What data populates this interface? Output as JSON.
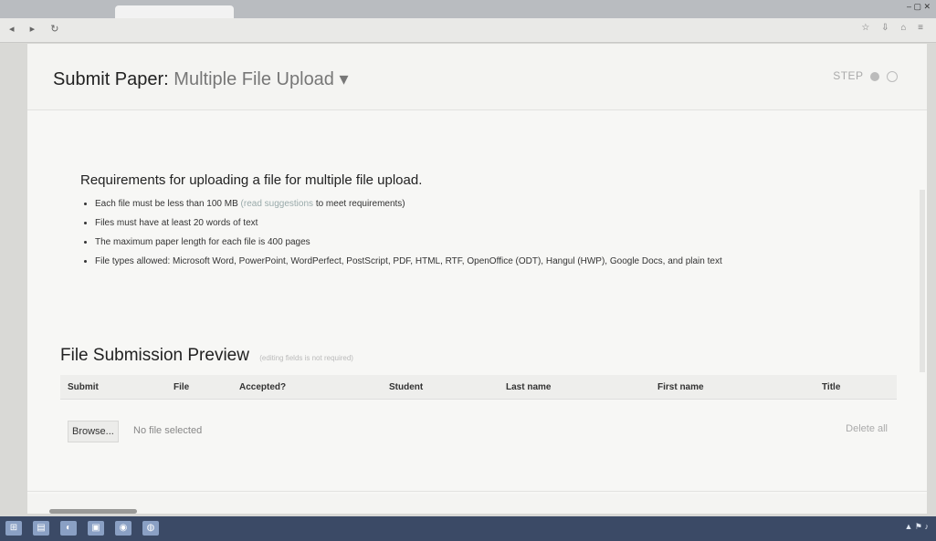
{
  "browser": {
    "tab_title": "",
    "url": "",
    "window_controls": "– ▢ ✕",
    "nav_icons": [
      "back-icon",
      "forward-icon",
      "refresh-icon"
    ],
    "toolbar_icons": [
      "bookmark-icon",
      "download-icon",
      "home-icon",
      "menu-icon"
    ]
  },
  "page": {
    "title_prefix": "Submit Paper:",
    "title_mode": "Multiple File Upload",
    "title_caret": "▾",
    "step_label": "STEP"
  },
  "requirements": {
    "heading": "Requirements for uploading a file for multiple file upload.",
    "items": [
      {
        "text": "Each file must be less than 100 MB",
        "link": "(read suggestions",
        "tail": "to meet requirements)"
      },
      {
        "text": "Files must have at least 20 words of text"
      },
      {
        "text": "The maximum paper length for each file is 400 pages"
      },
      {
        "text": "File types allowed: Microsoft Word, PowerPoint, WordPerfect, PostScript, PDF, HTML, RTF, OpenOffice (ODT), Hangul (HWP), Google Docs, and plain text"
      }
    ]
  },
  "preview": {
    "title": "File Submission Preview",
    "note": "(editing fields is not required)",
    "columns": [
      "Submit",
      "File",
      "Accepted?",
      "Student",
      "Last name",
      "First name",
      "Title"
    ],
    "browse_label": "Browse...",
    "no_file_text": "No file selected",
    "delete_all_label": "Delete all"
  },
  "taskbar": {
    "icons": [
      "start-icon",
      "explorer-icon",
      "browser-icon",
      "app-icon",
      "chrome-icon",
      "camera-icon"
    ]
  }
}
